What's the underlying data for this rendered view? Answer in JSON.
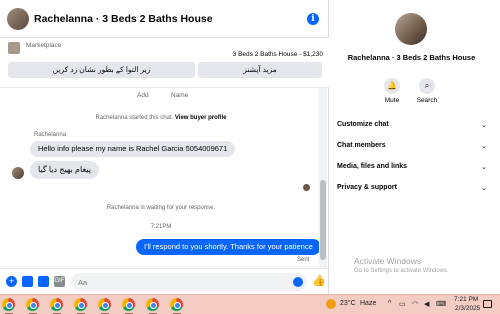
{
  "chat": {
    "title": "Rachelanna · 3 Beds 2 Baths House",
    "marketplace_label": "Marketplace",
    "listing": "3 Beds 2 Baths House - $1,230",
    "mark_pending_label": "زیر التوا کے بطور نشان زد کریں",
    "more_options_label": "مزید آپشنز",
    "tab_add": "Add",
    "tab_name": "Name",
    "started_text": "Rachelanna started this chat.",
    "view_profile": "View buyer profile",
    "sender": "Rachelanna",
    "messages_in": [
      "Hello info please my name is Rachel Garcia 5054009671",
      "پیغام بھیج دیا گیا"
    ],
    "waiting_text": "Rachelanna is waiting for your response.",
    "time_separator": "7:21PM",
    "message_out": "I'll respond to you shortly. Thanks for your patience",
    "sent_label": "Sent",
    "input_placeholder": "Aa",
    "accent_color": "#0866ff"
  },
  "panel": {
    "title": "Rachelanna · 3 Beds 2 Baths House",
    "mute_label": "Mute",
    "search_label": "Search",
    "sections": [
      "Customize chat",
      "Chat members",
      "Media, files and links",
      "Privacy & support"
    ],
    "watermark_title": "Activate Windows",
    "watermark_sub": "Go to Settings to activate Windows."
  },
  "taskbar": {
    "temperature": "23°C",
    "weather": "Haze",
    "time": "7:21 PM",
    "date": "2/3/2025",
    "background": "#f3ccc4"
  }
}
